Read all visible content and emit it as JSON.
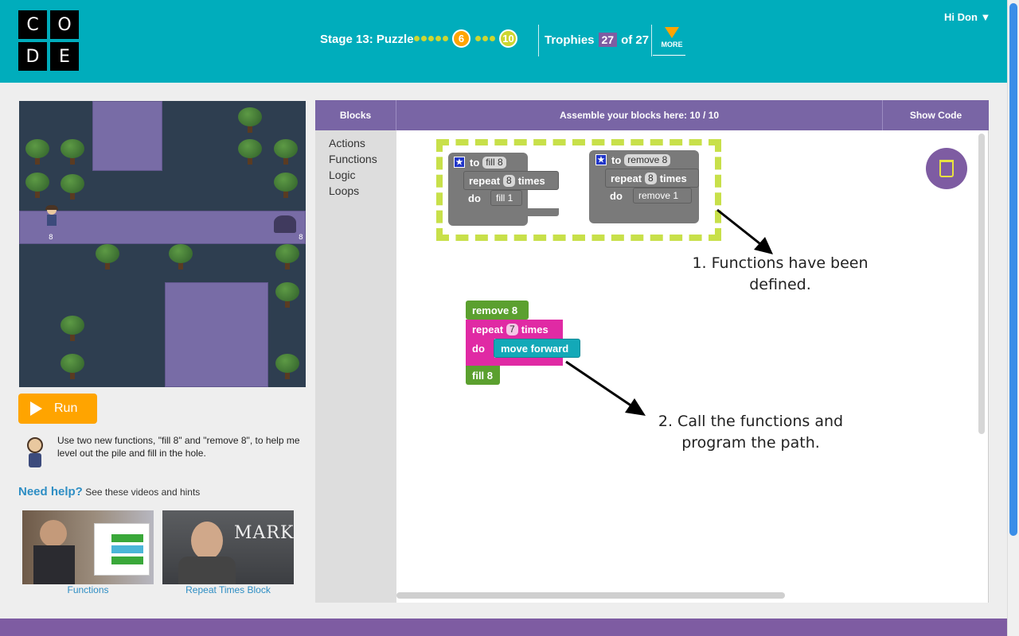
{
  "header": {
    "logo_letters": [
      "C",
      "O",
      "D",
      "E"
    ],
    "stage_label": "Stage 13: Puzzle",
    "current_puzzle": "6",
    "last_puzzle": "10",
    "trophies_label": "Trophies",
    "trophies_count": "27",
    "trophies_total": "of 27",
    "more_label": "MORE",
    "user_greeting": "Hi Don ▼",
    "colors": {
      "accent": "#00adbc",
      "current": "#ffa400",
      "dot": "#cdd631",
      "purple": "#7e5ca2"
    }
  },
  "game": {
    "pile_height": "8",
    "hole_depth": "8"
  },
  "run_button": {
    "label": "Run"
  },
  "instructions": "Use two new functions, \"fill 8\" and \"remove 8\", to help me level out the pile and fill in the hole.",
  "help": {
    "title": "Need help?",
    "subtitle": "See these videos and hints",
    "videos": [
      {
        "caption": "Functions"
      },
      {
        "caption": "Repeat Times Block",
        "overlay": "MARK"
      }
    ]
  },
  "workspace": {
    "toolbox_header": "Blocks",
    "workspace_header": "Assemble your blocks here: 10 / 10",
    "show_code": "Show Code",
    "categories": [
      "Actions",
      "Functions",
      "Logic",
      "Loops"
    ],
    "function_fill": {
      "to": "to",
      "name": "fill 8",
      "repeat": "repeat",
      "count": "8",
      "times": "times",
      "do": "do",
      "inner": "fill 1"
    },
    "function_remove": {
      "to": "to",
      "name": "remove 8",
      "repeat": "repeat",
      "count": "8",
      "times": "times",
      "do": "do",
      "inner": "remove 1"
    },
    "program": {
      "call_remove": "remove 8",
      "repeat": "repeat",
      "count": "7",
      "times": "times",
      "do": "do",
      "inner": "move forward",
      "call_fill": "fill 8"
    },
    "note_1": {
      "line1": "1. Functions have been",
      "line2": "defined."
    },
    "note_2": {
      "line1": "2. Call the functions and",
      "line2": "program the path."
    }
  }
}
